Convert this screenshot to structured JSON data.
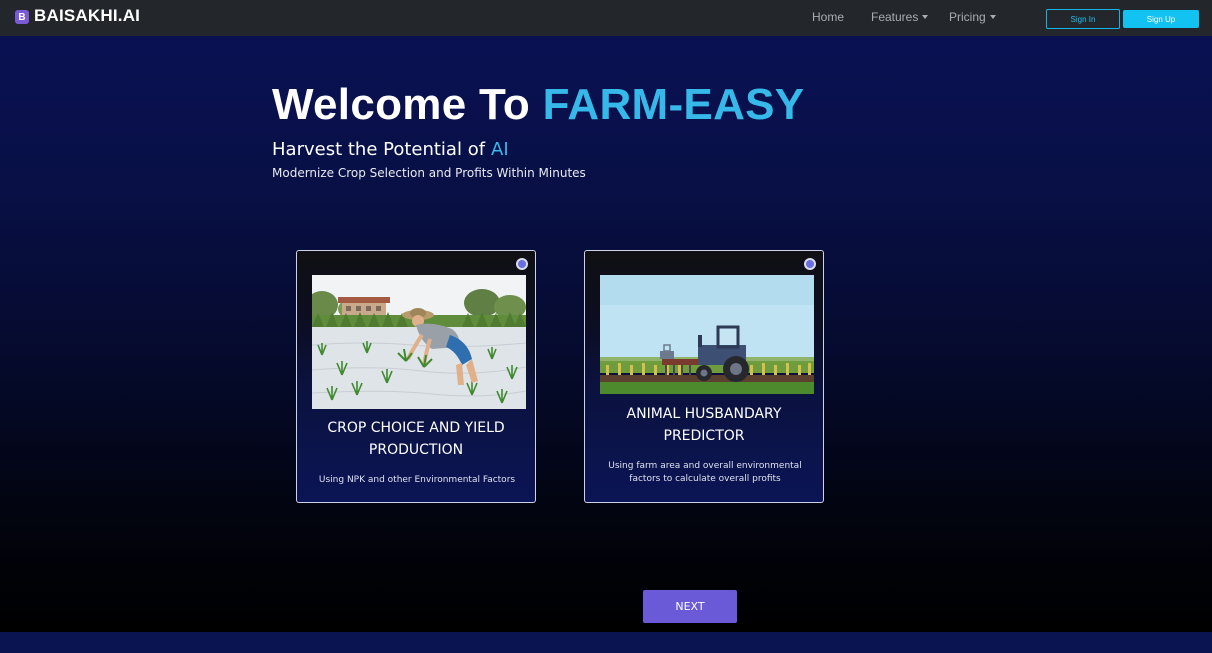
{
  "navbar": {
    "logo_letter": "B",
    "brand": "BAISAKHI.AI",
    "links": {
      "home": "Home",
      "features": "Features",
      "pricing": "Pricing"
    },
    "sign_in": "Sign In",
    "sign_up": "Sign Up"
  },
  "hero": {
    "title_prefix": "Welcome To",
    "title_accent": "FARM-EASY",
    "subtitle": "Harvest the Potential of",
    "subtitle_accent": "AI",
    "tagline": "Modernize Crop Selection and Profits Within Minutes"
  },
  "cards": [
    {
      "title": "CROP CHOICE AND YIELD PRODUCTION",
      "description": "Using NPK and other Environmental Factors",
      "image_icon": "farmer-planting-rice-illustration"
    },
    {
      "title": "ANIMAL HUSBANDARY PREDICTOR",
      "description": "Using farm area and overall environmental factors to calculate overall profits",
      "image_icon": "tractor-field-illustration"
    }
  ],
  "next_button": "NEXT",
  "colors": {
    "accent_cyan": "#36b8e8",
    "button_purple": "#6a5ad8",
    "navbar_bg": "#23272b",
    "signup_bg": "#12c2f0"
  }
}
